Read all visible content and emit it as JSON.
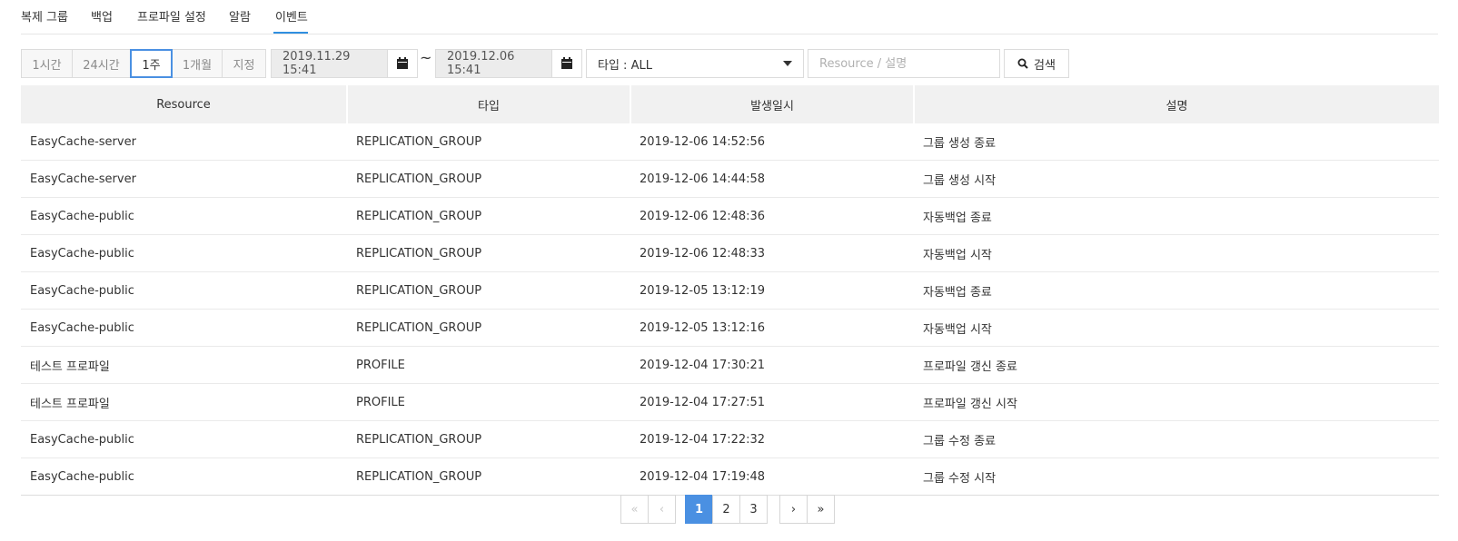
{
  "tabs": [
    "복제 그룹",
    "백업",
    "프로파일 설정",
    "알람",
    "이벤트"
  ],
  "active_tab": "이벤트",
  "period_buttons": [
    "1시간",
    "24시간",
    "1주",
    "1개월",
    "지정"
  ],
  "active_period": "1주",
  "date_from": "2019.11.29 15:41",
  "date_to": "2019.12.06 15:41",
  "tilde": "~",
  "type_select": "타입 : ALL",
  "search": {
    "placeholder": "Resource / 설명",
    "value": "",
    "button_label": "검색"
  },
  "table": {
    "headers": [
      "Resource",
      "타입",
      "발생일시",
      "설명"
    ],
    "rows": [
      [
        "EasyCache-server",
        "REPLICATION_GROUP",
        "2019-12-06 14:52:56",
        "그룹 생성 종료"
      ],
      [
        "EasyCache-server",
        "REPLICATION_GROUP",
        "2019-12-06 14:44:58",
        "그룹 생성 시작"
      ],
      [
        "EasyCache-public",
        "REPLICATION_GROUP",
        "2019-12-06 12:48:36",
        "자동백업 종료"
      ],
      [
        "EasyCache-public",
        "REPLICATION_GROUP",
        "2019-12-06 12:48:33",
        "자동백업 시작"
      ],
      [
        "EasyCache-public",
        "REPLICATION_GROUP",
        "2019-12-05 13:12:19",
        "자동백업 종료"
      ],
      [
        "EasyCache-public",
        "REPLICATION_GROUP",
        "2019-12-05 13:12:16",
        "자동백업 시작"
      ],
      [
        "테스트 프로파일",
        "PROFILE",
        "2019-12-04 17:30:21",
        "프로파일 갱신 종료"
      ],
      [
        "테스트 프로파일",
        "PROFILE",
        "2019-12-04 17:27:51",
        "프로파일 갱신 시작"
      ],
      [
        "EasyCache-public",
        "REPLICATION_GROUP",
        "2019-12-04 17:22:32",
        "그룹 수정 종료"
      ],
      [
        "EasyCache-public",
        "REPLICATION_GROUP",
        "2019-12-04 17:19:48",
        "그룹 수정 시작"
      ]
    ]
  },
  "pagination": {
    "first": "«",
    "prev": "‹",
    "pages": [
      "1",
      "2",
      "3"
    ],
    "current": "1",
    "next": "›",
    "last": "»"
  }
}
